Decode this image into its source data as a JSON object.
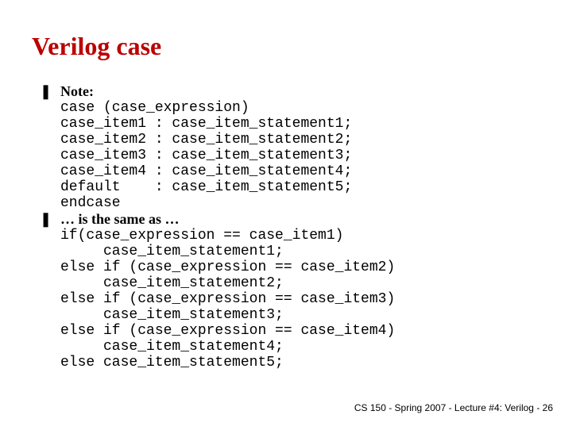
{
  "title": "Verilog case",
  "bullets": {
    "b1_label": "Note:",
    "b2_label": "… is the same as …"
  },
  "code1": {
    "l1": "case (case_expression)",
    "l2": "case_item1 : case_item_statement1;",
    "l3": "case_item2 : case_item_statement2;",
    "l4": "case_item3 : case_item_statement3;",
    "l5": "case_item4 : case_item_statement4;",
    "l6": "default    : case_item_statement5;",
    "l7": "endcase"
  },
  "code2": {
    "l1": "if(case_expression == case_item1)",
    "l2": "     case_item_statement1;",
    "l3": "else if (case_expression == case_item2)",
    "l4": "     case_item_statement2;",
    "l5": "else if (case_expression == case_item3)",
    "l6": "     case_item_statement3;",
    "l7": "else if (case_expression == case_item4)",
    "l8": "     case_item_statement4;",
    "l9": "else case_item_statement5;"
  },
  "footer": "CS 150 - Spring 2007 - Lecture #4: Verilog - 26"
}
